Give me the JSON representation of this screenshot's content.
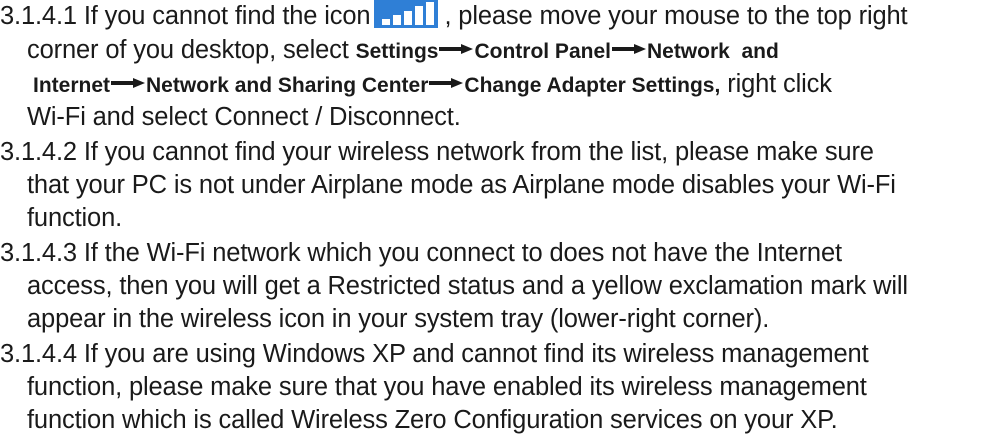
{
  "items": [
    {
      "number": "3.1.4.1",
      "line1_before_icon": "3.1.4.1 If you cannot find the icon",
      "line1_after_icon": ", please move your mouse to the top right",
      "icon": "wifi-signal-icon",
      "line2_prefix": "corner of you desktop, select ",
      "path": [
        "Settings",
        "Control Panel",
        "Network and Internet",
        "Network and Sharing Center",
        "Change Adapter Settings,"
      ],
      "path_network_part1": "Network  and",
      "path_network_part2": "Internet",
      "line3_suffix": " right click",
      "line4": "Wi-Fi and select Connect / Disconnect."
    },
    {
      "number": "3.1.4.2",
      "lines": [
        "3.1.4.2 If you cannot find your wireless network from the list, please make sure",
        "that your PC is not under Airplane mode as Airplane mode disables your Wi-Fi",
        "function."
      ]
    },
    {
      "number": "3.1.4.3",
      "lines": [
        "3.1.4.3 If the Wi-Fi network which you connect to does not have the Internet",
        "access, then you will get a Restricted status and a yellow exclamation mark will",
        "appear in the wireless icon in your system tray (lower-right corner)."
      ]
    },
    {
      "number": "3.1.4.4",
      "lines": [
        "3.1.4.4 If you are using Windows XP and cannot find its wireless management",
        "function, please make sure that you have enabled its wireless management",
        "function which is called Wireless Zero Configuration services on your XP."
      ]
    }
  ],
  "colors": {
    "text": "#1a1a1a",
    "icon_background": "#2f7fd6",
    "icon_bars": "#ffffff"
  }
}
